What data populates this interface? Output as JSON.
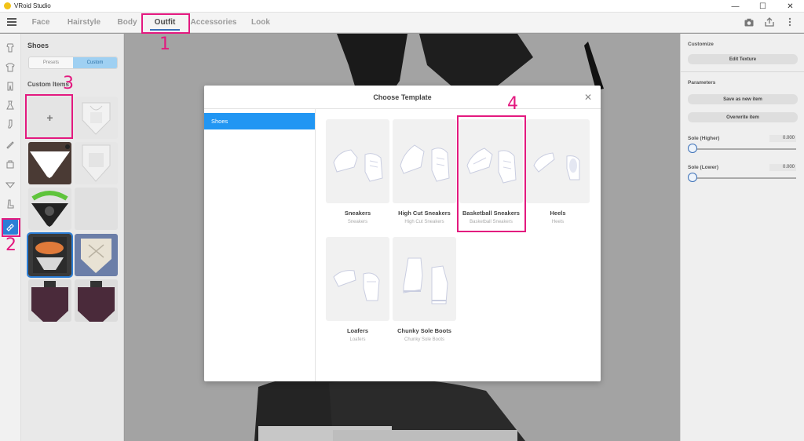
{
  "window": {
    "title": "VRoid Studio"
  },
  "tabs": [
    {
      "label": "Face"
    },
    {
      "label": "Hairstyle"
    },
    {
      "label": "Body"
    },
    {
      "label": "Outfit"
    },
    {
      "label": "Accessories"
    },
    {
      "label": "Look"
    }
  ],
  "item_panel": {
    "heading": "Shoes",
    "presets_label": "Presets",
    "custom_label": "Custom",
    "custom_items_label": "Custom Items",
    "add_symbol": "+"
  },
  "right_panel": {
    "customize_label": "Customize",
    "edit_texture_label": "Edit Texture",
    "parameters_label": "Parameters",
    "save_new_label": "Save as new item",
    "overwrite_label": "Overwrite item",
    "sole_higher_label": "Sole (Higher)",
    "sole_higher_value": "0.000",
    "sole_lower_label": "Sole (Lower)",
    "sole_lower_value": "0.000"
  },
  "modal": {
    "title": "Choose Template",
    "close_symbol": "✕",
    "category": "Shoes",
    "templates": [
      {
        "name": "Sneakers",
        "desc": "Sneakers"
      },
      {
        "name": "High Cut Sneakers",
        "desc": "High Cut Sneakers"
      },
      {
        "name": "Basketball Sneakers",
        "desc": "Basketball Sneakers"
      },
      {
        "name": "Heels",
        "desc": "Heels"
      },
      {
        "name": "Loafers",
        "desc": "Loafers"
      },
      {
        "name": "Chunky Sole Boots",
        "desc": "Chunky Sole Boots"
      }
    ]
  },
  "annotations": [
    "1",
    "2",
    "3",
    "4"
  ],
  "colors": {
    "accent": "#2196f3",
    "annotation": "#e3197f",
    "rail_active": "#2c7ed6"
  }
}
